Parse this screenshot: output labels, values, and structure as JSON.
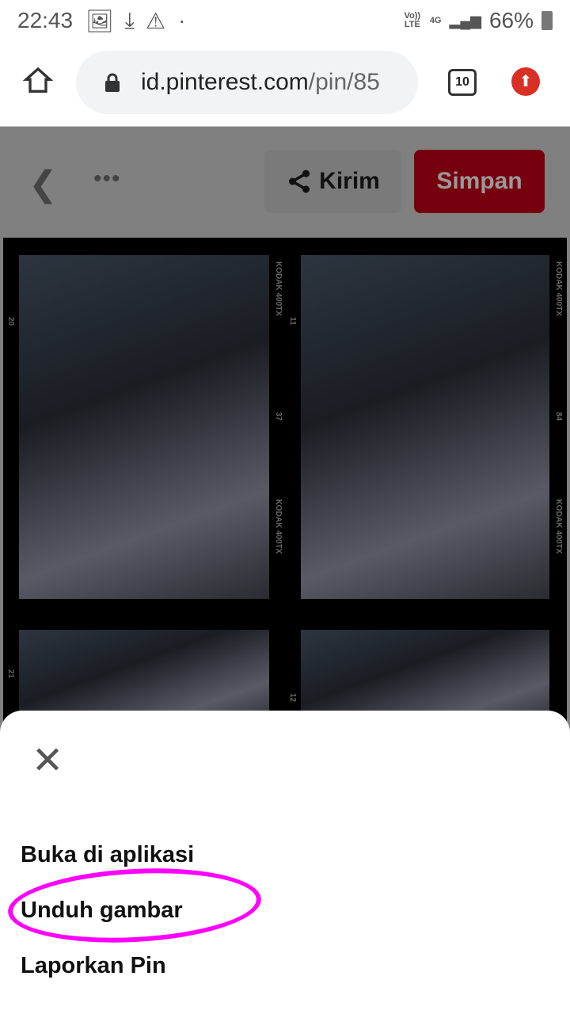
{
  "status_bar": {
    "time": "22:43",
    "icons": [
      "image-icon",
      "download-icon",
      "warning-icon",
      "dot-icon"
    ],
    "volte": "Vo)) LTE",
    "network": "4G",
    "battery": "66%"
  },
  "browser": {
    "url_main": "id.pinterest.com",
    "url_path": "/pin/85",
    "tab_count": "10"
  },
  "pin_bar": {
    "send_label": "Kirim",
    "save_label": "Simpan",
    "save_color": "#e60023"
  },
  "film": {
    "brand": "KODAK 400TX",
    "frame_numbers": [
      "20",
      "11",
      "37",
      "84",
      "21",
      "12"
    ]
  },
  "sheet": {
    "items": [
      {
        "label": "Buka di aplikasi"
      },
      {
        "label": "Unduh gambar"
      },
      {
        "label": "Laporkan Pin"
      }
    ],
    "highlight_color": "#ff00ff"
  }
}
